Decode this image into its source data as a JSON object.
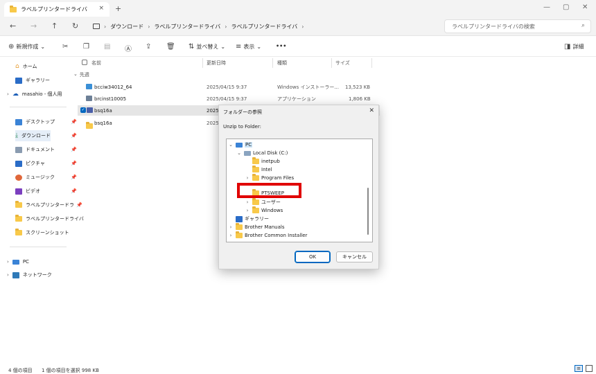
{
  "window": {
    "tab_title": "ラベルプリンタードライバ",
    "tab_close": "×",
    "new_tab": "+",
    "minimize": "—",
    "maximize": "▢",
    "close": "✕"
  },
  "nav": {
    "back": "←",
    "forward": "→",
    "up": "↑",
    "refresh": "↻",
    "breadcrumbs": [
      "ダウンロード",
      "ラベルプリンタードライバ",
      "ラベルプリンタードライバ"
    ],
    "search_placeholder": "ラベルプリンタードライバの検索"
  },
  "toolbar": {
    "new_label": "新規作成",
    "sort_label": "並べ替え",
    "view_label": "表示",
    "more_label": "•••",
    "details_label": "詳細"
  },
  "sidebar": {
    "items": [
      {
        "label": "ホーム"
      },
      {
        "label": "ギャラリー"
      },
      {
        "label": "masahio - 個人用"
      },
      {
        "label": "デスクトップ"
      },
      {
        "label": "ダウンロード"
      },
      {
        "label": "ドキュメント"
      },
      {
        "label": "ピクチャ"
      },
      {
        "label": "ミュージック"
      },
      {
        "label": "ビデオ"
      },
      {
        "label": "ラベルプリンタードラ"
      },
      {
        "label": "ラベルプリンタードライバ"
      },
      {
        "label": "スクリーンショット"
      },
      {
        "label": "PC"
      },
      {
        "label": "ネットワーク"
      }
    ]
  },
  "columns": {
    "name": "名前",
    "date": "更新日時",
    "type": "種類",
    "size": "サイズ"
  },
  "group_label": "先週",
  "files": [
    {
      "name": "bcciw34012_64",
      "date": "2025/04/15 9:37",
      "type": "Windows インストーラー...",
      "size": "13,523 KB"
    },
    {
      "name": "brcinst10005",
      "date": "2025/04/15 9:37",
      "type": "アプリケーション",
      "size": "1,806 KB"
    },
    {
      "name": "bsq16a",
      "date": "2025",
      "type": "",
      "size": ""
    },
    {
      "name": "bsq16a",
      "date": "2025",
      "type": "",
      "size": ""
    }
  ],
  "status": {
    "count": "4 個の項目",
    "selection": "1 個の項目を選択  998 KB"
  },
  "dialog": {
    "title": "フォルダーの参照",
    "prompt": "Unzip to Folder:",
    "tree": [
      "PC",
      "Local Disk (C:)",
      "inetpub",
      "Intel",
      "Program Files",
      "PTSWEEP",
      "ユーザー",
      "Windows",
      "ギャラリー",
      "Brother Manuals",
      "Brother Common Installer"
    ],
    "ok": "OK",
    "cancel": "キャンセル"
  },
  "colors": {
    "highlight": "#e00000",
    "accent": "#0067c0",
    "folder": "#f8c94a"
  }
}
